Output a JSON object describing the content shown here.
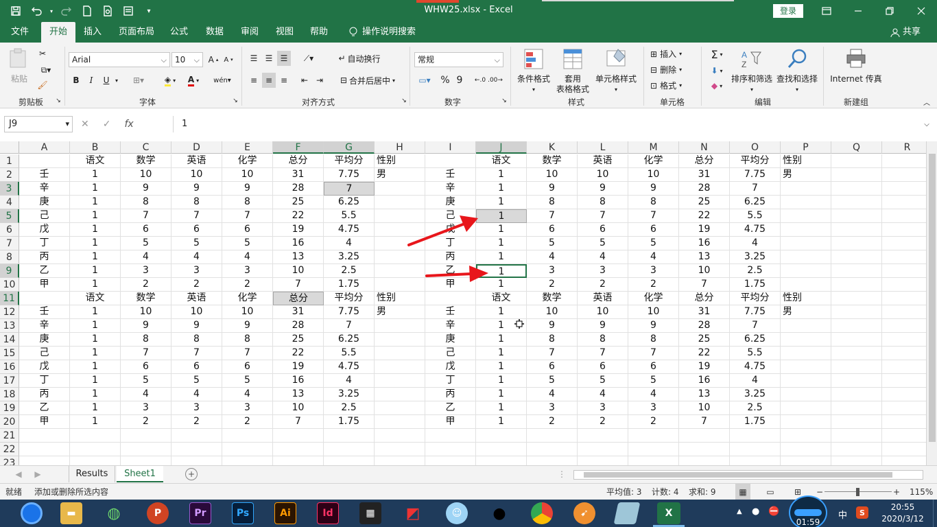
{
  "window": {
    "title": "WHW25.xlsx  -  Excel",
    "login": "登录"
  },
  "tabs": [
    "文件",
    "开始",
    "插入",
    "页面布局",
    "公式",
    "数据",
    "审阅",
    "视图",
    "帮助"
  ],
  "tellme": "操作说明搜索",
  "share": "共享",
  "ribbon": {
    "clipboard": {
      "paste": "粘贴",
      "label": "剪贴板"
    },
    "font": {
      "name": "Arial",
      "size": "10",
      "label": "字体",
      "bold": "B",
      "italic": "I",
      "underline": "U"
    },
    "align": {
      "wrap": "自动换行",
      "merge": "合并后居中",
      "label": "对齐方式"
    },
    "number": {
      "format": "常规",
      "label": "数字",
      "percent": "%",
      "comma": "9"
    },
    "styles": {
      "cond": "条件格式",
      "table_l1": "套用",
      "table_l2": "表格格式",
      "cell": "单元格样式",
      "label": "样式"
    },
    "cells": {
      "insert": "插入",
      "delete": "删除",
      "format": "格式",
      "label": "单元格"
    },
    "edit": {
      "sort": "排序和筛选",
      "find": "查找和选择",
      "label": "编辑"
    },
    "newgroup": {
      "fax": "Internet 传真",
      "label": "新建组"
    }
  },
  "formula": {
    "namebox": "J9",
    "value": "1",
    "fx": "fx"
  },
  "columns": [
    "A",
    "B",
    "C",
    "D",
    "E",
    "F",
    "G",
    "H",
    "I",
    "J",
    "K",
    "L",
    "M",
    "N",
    "O",
    "P",
    "Q",
    "R"
  ],
  "rows": [
    [
      "",
      "语文",
      "数学",
      "英语",
      "化学",
      "总分",
      "平均分",
      "性别",
      "",
      "语文",
      "数学",
      "英语",
      "化学",
      "总分",
      "平均分",
      "性别",
      "",
      ""
    ],
    [
      "壬",
      "1",
      "10",
      "10",
      "10",
      "31",
      "7.75",
      "男",
      "壬",
      "1",
      "10",
      "10",
      "10",
      "31",
      "7.75",
      "男",
      "",
      ""
    ],
    [
      "辛",
      "1",
      "9",
      "9",
      "9",
      "28",
      "7",
      "",
      "辛",
      "1",
      "9",
      "9",
      "9",
      "28",
      "7",
      "",
      "",
      ""
    ],
    [
      "庚",
      "1",
      "8",
      "8",
      "8",
      "25",
      "6.25",
      "",
      "庚",
      "1",
      "8",
      "8",
      "8",
      "25",
      "6.25",
      "",
      "",
      ""
    ],
    [
      "己",
      "1",
      "7",
      "7",
      "7",
      "22",
      "5.5",
      "",
      "己",
      "1",
      "7",
      "7",
      "7",
      "22",
      "5.5",
      "",
      "",
      ""
    ],
    [
      "戊",
      "1",
      "6",
      "6",
      "6",
      "19",
      "4.75",
      "",
      "戊",
      "1",
      "6",
      "6",
      "6",
      "19",
      "4.75",
      "",
      "",
      ""
    ],
    [
      "丁",
      "1",
      "5",
      "5",
      "5",
      "16",
      "4",
      "",
      "丁",
      "1",
      "5",
      "5",
      "5",
      "16",
      "4",
      "",
      "",
      ""
    ],
    [
      "丙",
      "1",
      "4",
      "4",
      "4",
      "13",
      "3.25",
      "",
      "丙",
      "1",
      "4",
      "4",
      "4",
      "13",
      "3.25",
      "",
      "",
      ""
    ],
    [
      "乙",
      "1",
      "3",
      "3",
      "3",
      "10",
      "2.5",
      "",
      "乙",
      "1",
      "3",
      "3",
      "3",
      "10",
      "2.5",
      "",
      "",
      ""
    ],
    [
      "甲",
      "1",
      "2",
      "2",
      "2",
      "7",
      "1.75",
      "",
      "甲",
      "1",
      "2",
      "2",
      "2",
      "7",
      "1.75",
      "",
      "",
      ""
    ],
    [
      "",
      "语文",
      "数学",
      "英语",
      "化学",
      "总分",
      "平均分",
      "性别",
      "",
      "语文",
      "数学",
      "英语",
      "化学",
      "总分",
      "平均分",
      "性别",
      "",
      ""
    ],
    [
      "壬",
      "1",
      "10",
      "10",
      "10",
      "31",
      "7.75",
      "男",
      "壬",
      "1",
      "10",
      "10",
      "10",
      "31",
      "7.75",
      "男",
      "",
      ""
    ],
    [
      "辛",
      "1",
      "9",
      "9",
      "9",
      "28",
      "7",
      "",
      "辛",
      "1",
      "9",
      "9",
      "9",
      "28",
      "7",
      "",
      "",
      ""
    ],
    [
      "庚",
      "1",
      "8",
      "8",
      "8",
      "25",
      "6.25",
      "",
      "庚",
      "1",
      "8",
      "8",
      "8",
      "25",
      "6.25",
      "",
      "",
      ""
    ],
    [
      "己",
      "1",
      "7",
      "7",
      "7",
      "22",
      "5.5",
      "",
      "己",
      "1",
      "7",
      "7",
      "7",
      "22",
      "5.5",
      "",
      "",
      ""
    ],
    [
      "戊",
      "1",
      "6",
      "6",
      "6",
      "19",
      "4.75",
      "",
      "戊",
      "1",
      "6",
      "6",
      "6",
      "19",
      "4.75",
      "",
      "",
      ""
    ],
    [
      "丁",
      "1",
      "5",
      "5",
      "5",
      "16",
      "4",
      "",
      "丁",
      "1",
      "5",
      "5",
      "5",
      "16",
      "4",
      "",
      "",
      ""
    ],
    [
      "丙",
      "1",
      "4",
      "4",
      "4",
      "13",
      "3.25",
      "",
      "丙",
      "1",
      "4",
      "4",
      "4",
      "13",
      "3.25",
      "",
      "",
      ""
    ],
    [
      "乙",
      "1",
      "3",
      "3",
      "3",
      "10",
      "2.5",
      "",
      "乙",
      "1",
      "3",
      "3",
      "3",
      "10",
      "2.5",
      "",
      "",
      ""
    ],
    [
      "甲",
      "1",
      "2",
      "2",
      "2",
      "7",
      "1.75",
      "",
      "甲",
      "1",
      "2",
      "2",
      "2",
      "7",
      "1.75",
      "",
      "",
      ""
    ],
    [
      "",
      "",
      "",
      "",
      "",
      "",
      "",
      "",
      "",
      "",
      "",
      "",
      "",
      "",
      "",
      "",
      "",
      ""
    ],
    [
      "",
      "",
      "",
      "",
      "",
      "",
      "",
      "",
      "",
      "",
      "",
      "",
      "",
      "",
      "",
      "",
      "",
      ""
    ],
    [
      "",
      "",
      "",
      "",
      "",
      "",
      "",
      "",
      "",
      "",
      "",
      "",
      "",
      "",
      "",
      "",
      "",
      ""
    ]
  ],
  "highlighted_cells": [
    "G3",
    "J5",
    "F11"
  ],
  "active_cell": "J9",
  "selected_columns": [
    "F",
    "G",
    "J"
  ],
  "selected_rows": [
    "3",
    "5",
    "9",
    "11"
  ],
  "sheets": [
    "Results",
    "Sheet1"
  ],
  "active_sheet": "Sheet1",
  "status": {
    "ready": "就绪",
    "hint": "添加或删除所选内容",
    "average": "平均值: 3",
    "count": "计数: 4",
    "sum": "求和: 9",
    "zoom": "115%"
  },
  "taskbar": {
    "time": "20:55",
    "date": "2020/3/12",
    "ime": "中",
    "recorder": "01:59",
    "apps": [
      "Pr",
      "Ps",
      "Ai",
      "Id"
    ]
  },
  "colors": {
    "excel_green": "#217346",
    "arrow_red": "#e8161b"
  }
}
